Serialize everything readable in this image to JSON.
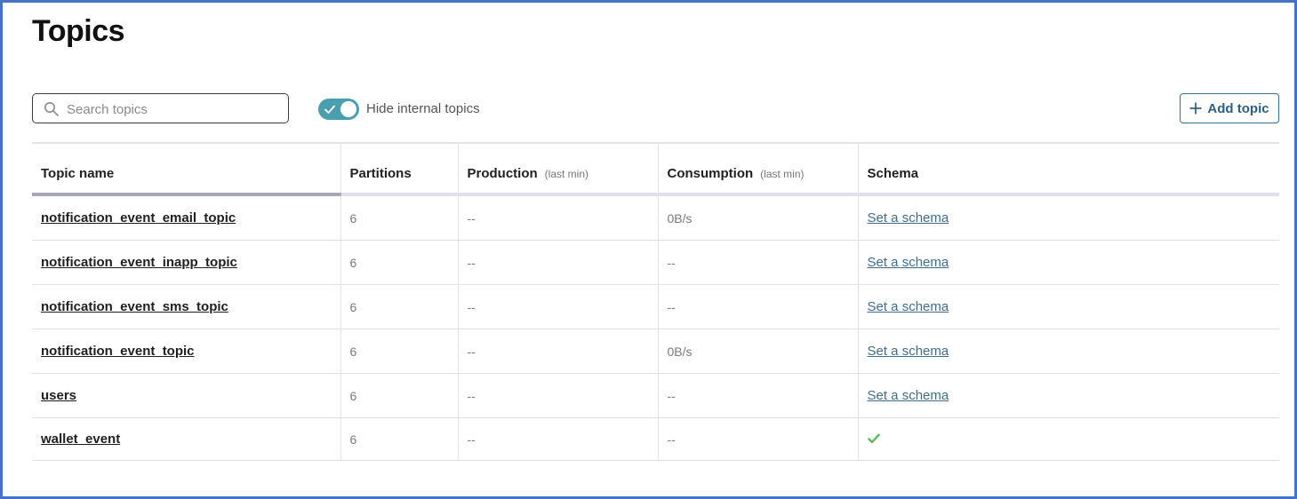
{
  "page": {
    "title": "Topics"
  },
  "toolbar": {
    "search_placeholder": "Search topics",
    "hide_internal_label": "Hide internal topics",
    "hide_internal_enabled": true,
    "add_topic_label": "Add topic"
  },
  "table": {
    "headers": {
      "name": "Topic name",
      "partitions": "Partitions",
      "production": "Production",
      "production_sub": "(last min)",
      "consumption": "Consumption",
      "consumption_sub": "(last min)",
      "schema": "Schema"
    },
    "rows": [
      {
        "name": "notification_event_email_topic",
        "partitions": "6",
        "production": "--",
        "consumption": "0B/s",
        "schema": "Set a schema"
      },
      {
        "name": "notification_event_inapp_topic",
        "partitions": "6",
        "production": "--",
        "consumption": "--",
        "schema": "Set a schema"
      },
      {
        "name": "notification_event_sms_topic",
        "partitions": "6",
        "production": "--",
        "consumption": "--",
        "schema": "Set a schema"
      },
      {
        "name": "notification_event_topic",
        "partitions": "6",
        "production": "--",
        "consumption": "0B/s",
        "schema": "Set a schema"
      },
      {
        "name": "users",
        "partitions": "6",
        "production": "--",
        "consumption": "--",
        "schema": "Set a schema"
      },
      {
        "name": "wallet_event",
        "partitions": "6",
        "production": "--",
        "consumption": "--",
        "schema_icon": "check-icon"
      }
    ]
  },
  "colors": {
    "accent": "#4a9fae",
    "link": "#3f6e8d",
    "success": "#5cb85c",
    "frame": "#4472c4"
  }
}
